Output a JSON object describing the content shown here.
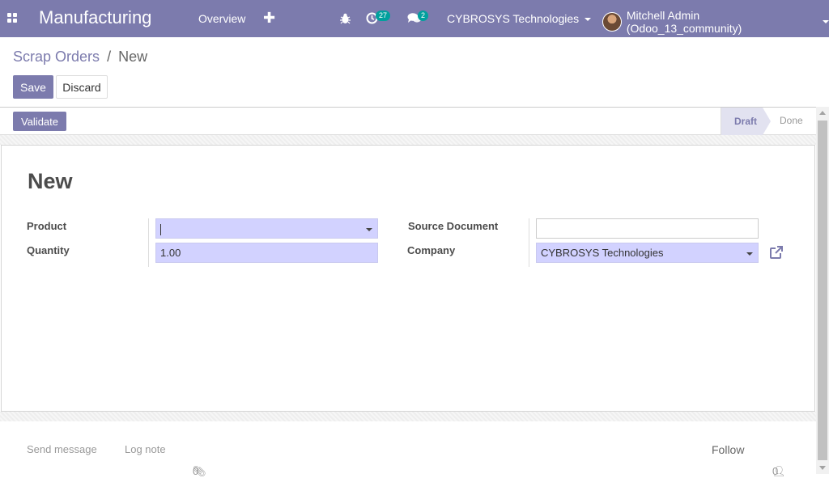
{
  "navbar": {
    "app_name": "Manufacturing",
    "menu_overview": "Overview",
    "create_icon": "plus-icon",
    "debug_icon": "bug-icon",
    "activity_count": "27",
    "message_count": "2",
    "company": "CYBROSYS Technologies",
    "user": "Mitchell Admin (Odoo_13_community)",
    "color": "#7c7bad"
  },
  "breadcrumb": {
    "parent": "Scrap Orders",
    "separator": "/",
    "current": "New"
  },
  "actions": {
    "save": "Save",
    "discard": "Discard",
    "validate": "Validate"
  },
  "statusbar": {
    "stages": [
      "Draft",
      "Done"
    ],
    "active_stage": "Draft"
  },
  "form": {
    "title": "New",
    "product_label": "Product",
    "product_value": "",
    "quantity_label": "Quantity",
    "quantity_value": "1.00",
    "source_document_label": "Source Document",
    "source_document_value": "",
    "company_label": "Company",
    "company_value": "CYBROSYS Technologies"
  },
  "chatter": {
    "send_message": "Send message",
    "log_note": "Log note",
    "attachments": "0",
    "follow": "Follow",
    "followers": "0"
  }
}
